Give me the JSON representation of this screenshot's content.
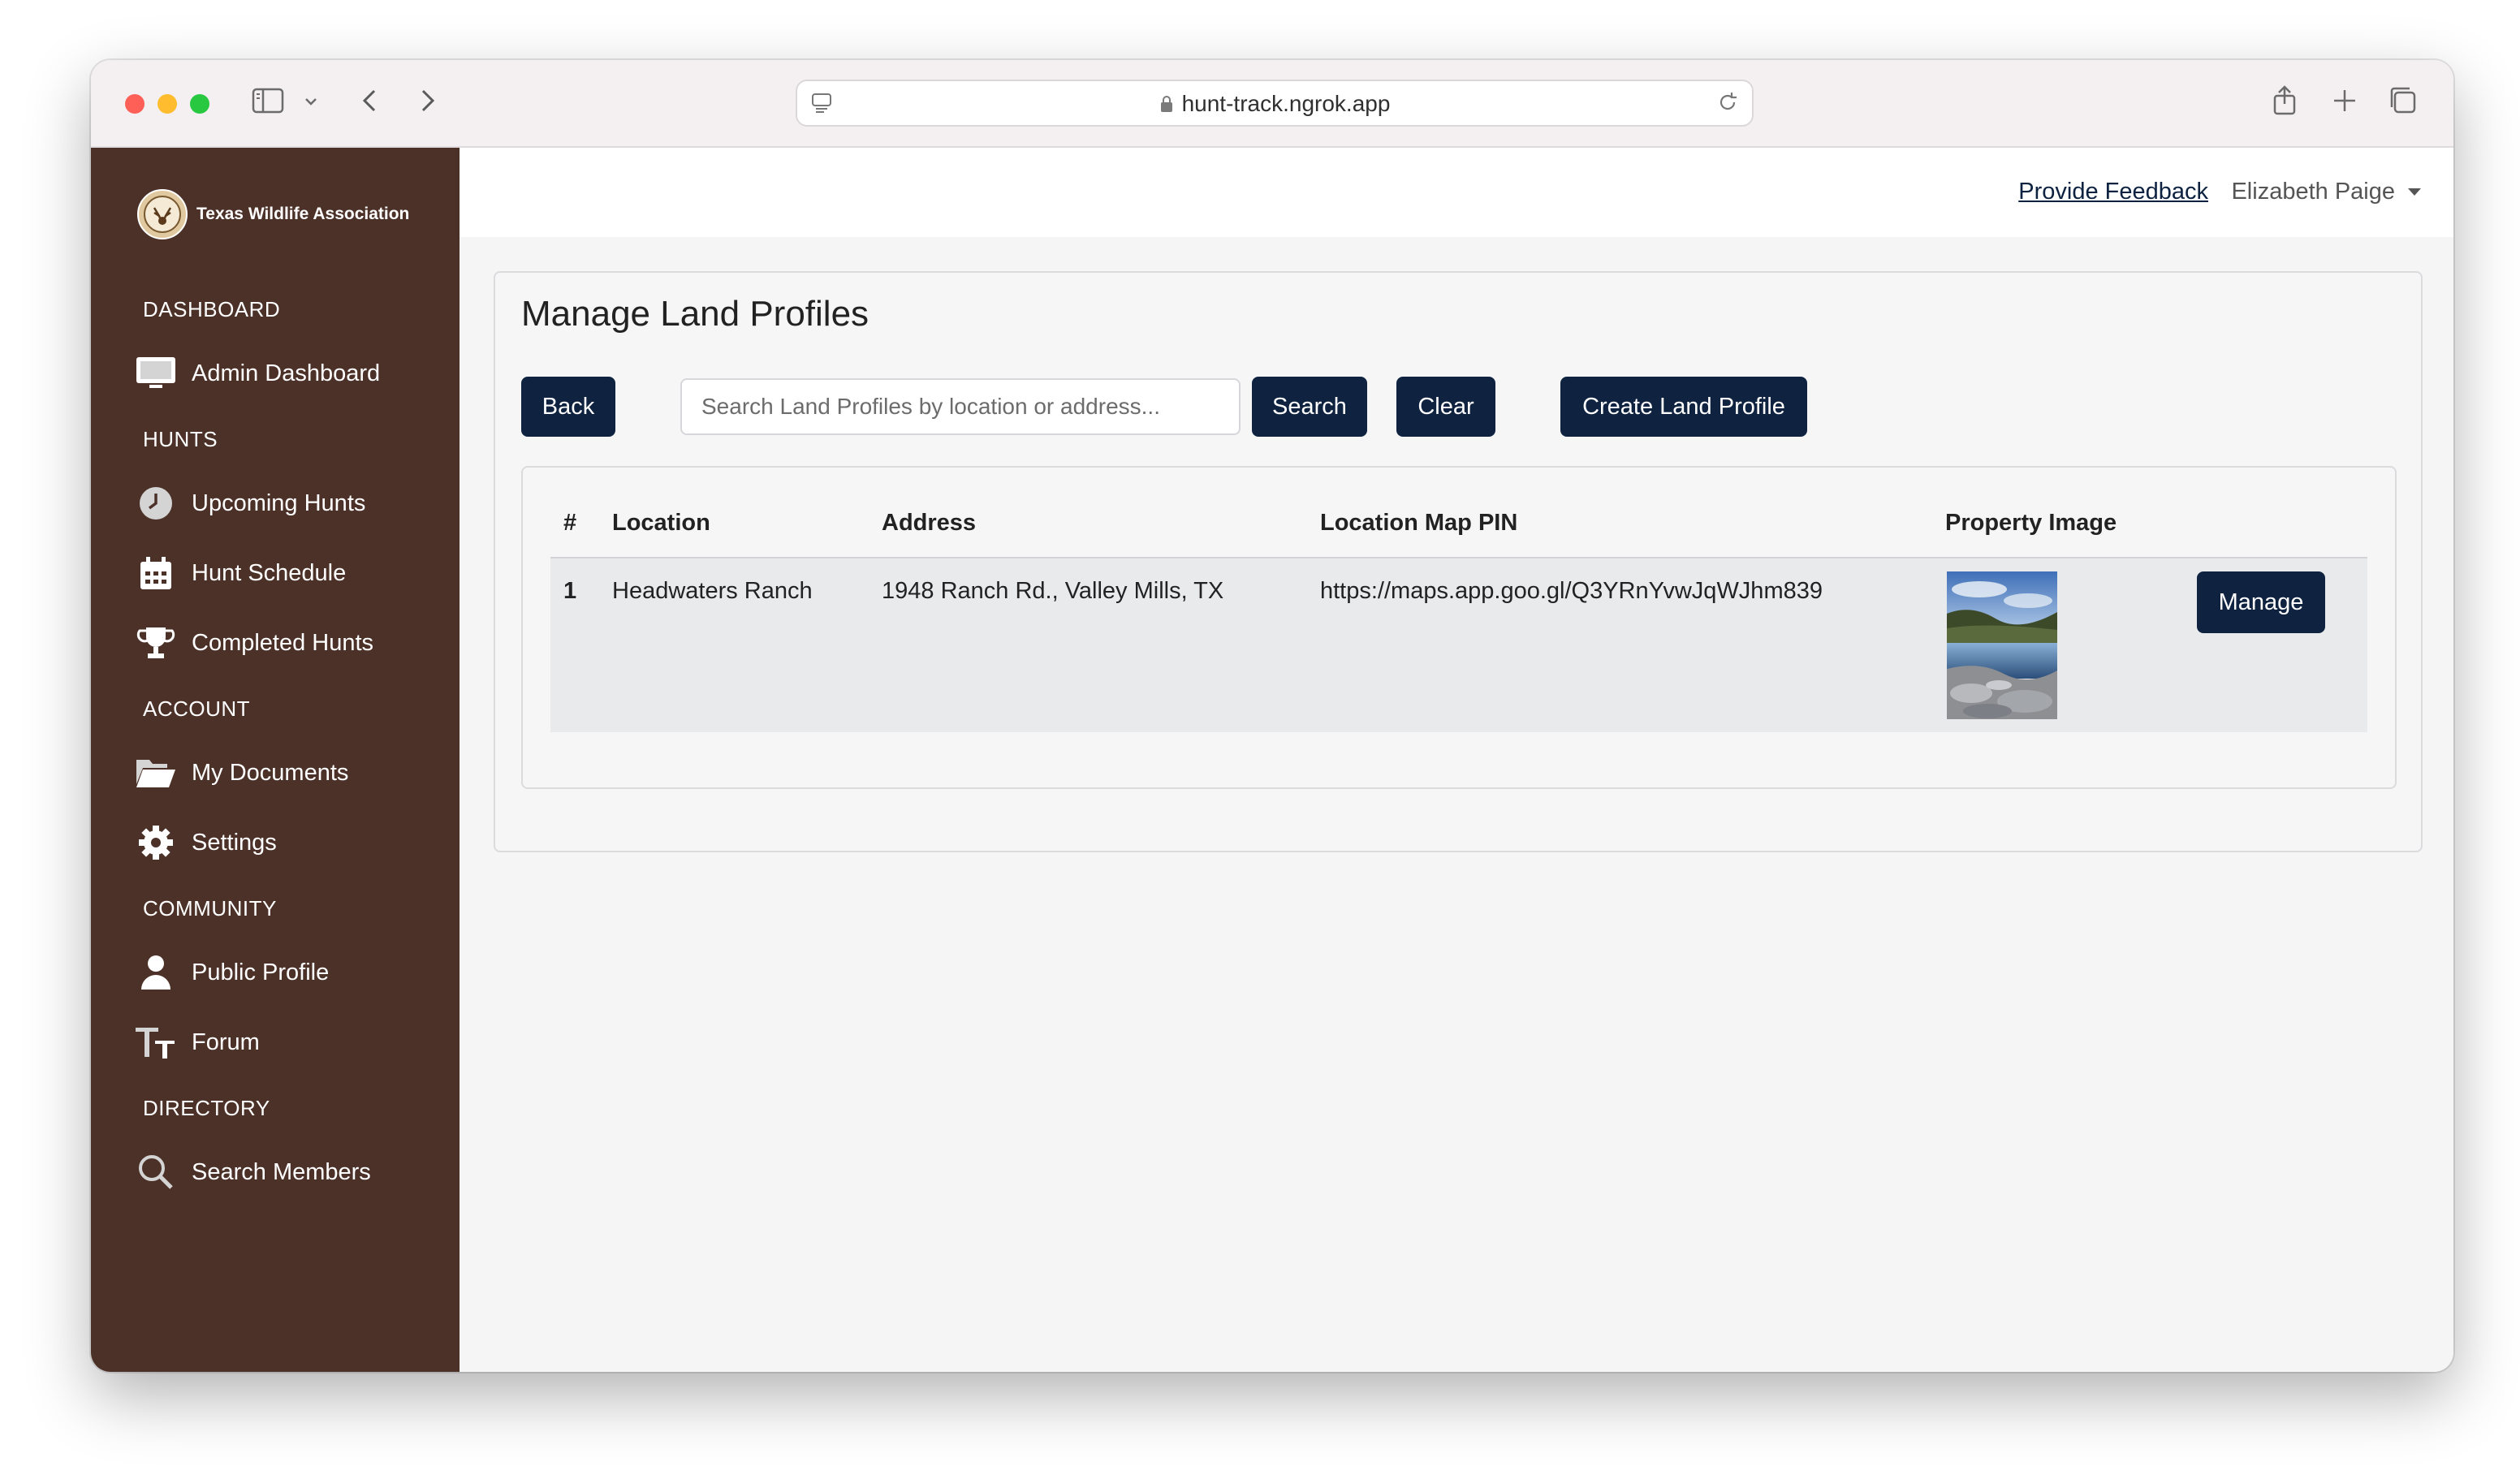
{
  "browser": {
    "url": "hunt-track.ngrok.app"
  },
  "sidebar": {
    "brand": "Texas Wildlife Association",
    "sections": {
      "dashboard": "DASHBOARD",
      "hunts": "HUNTS",
      "account": "ACCOUNT",
      "community": "COMMUNITY",
      "directory": "DIRECTORY"
    },
    "items": {
      "admin_dashboard": "Admin Dashboard",
      "upcoming_hunts": "Upcoming Hunts",
      "hunt_schedule": "Hunt Schedule",
      "completed_hunts": "Completed Hunts",
      "my_documents": "My Documents",
      "settings": "Settings",
      "public_profile": "Public Profile",
      "forum": "Forum",
      "search_members": "Search Members"
    }
  },
  "header": {
    "feedback_link": "Provide Feedback",
    "user_name": "Elizabeth Paige"
  },
  "page": {
    "title": "Manage Land Profiles",
    "back_label": "Back",
    "search_placeholder": "Search Land Profiles by location or address...",
    "search_label": "Search",
    "clear_label": "Clear",
    "create_label": "Create Land Profile"
  },
  "table": {
    "headers": {
      "num": "#",
      "location": "Location",
      "address": "Address",
      "pin": "Location Map PIN",
      "image": "Property Image"
    },
    "rows": [
      {
        "num": "1",
        "location": "Headwaters Ranch",
        "address": "1948 Ranch Rd., Valley Mills, TX",
        "pin": "https://maps.app.goo.gl/Q3YRnYvwJqWJhm839",
        "manage_label": "Manage"
      }
    ]
  },
  "colors": {
    "sidebar_bg": "#4c3128",
    "button_bg": "#0f2341"
  }
}
